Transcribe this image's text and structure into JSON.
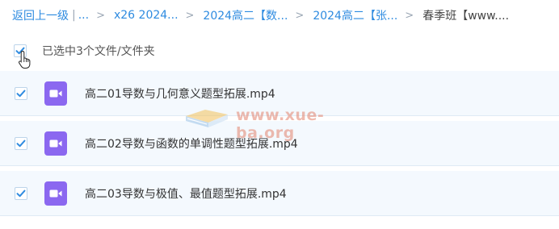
{
  "breadcrumb": {
    "back": "返回上一级",
    "separator_bar": "|",
    "ellipsis": "...",
    "crumbs": [
      "x26 2024...",
      "2024高二【数...",
      "2024高二【张..."
    ],
    "current": "春季班【www...."
  },
  "selection": {
    "label": "已选中3个文件/文件夹",
    "all_checked": true
  },
  "files": [
    {
      "name": "高二01导数与几何意义题型拓展.mp4",
      "checked": true,
      "icon": "video-file-icon"
    },
    {
      "name": "高二02导数与函数的单调性题型拓展.mp4",
      "checked": true,
      "icon": "video-file-icon"
    },
    {
      "name": "高二03导数与极值、最值题型拓展.mp4",
      "checked": true,
      "icon": "video-file-icon"
    }
  ],
  "watermark": {
    "text": "www.xue-ba.org"
  },
  "colors": {
    "link": "#2e8be0",
    "checkbox_check": "#2e8be0",
    "row_bg": "#f4f9fe",
    "video_icon": "#8b68f0",
    "watermark": "#e2836e"
  }
}
